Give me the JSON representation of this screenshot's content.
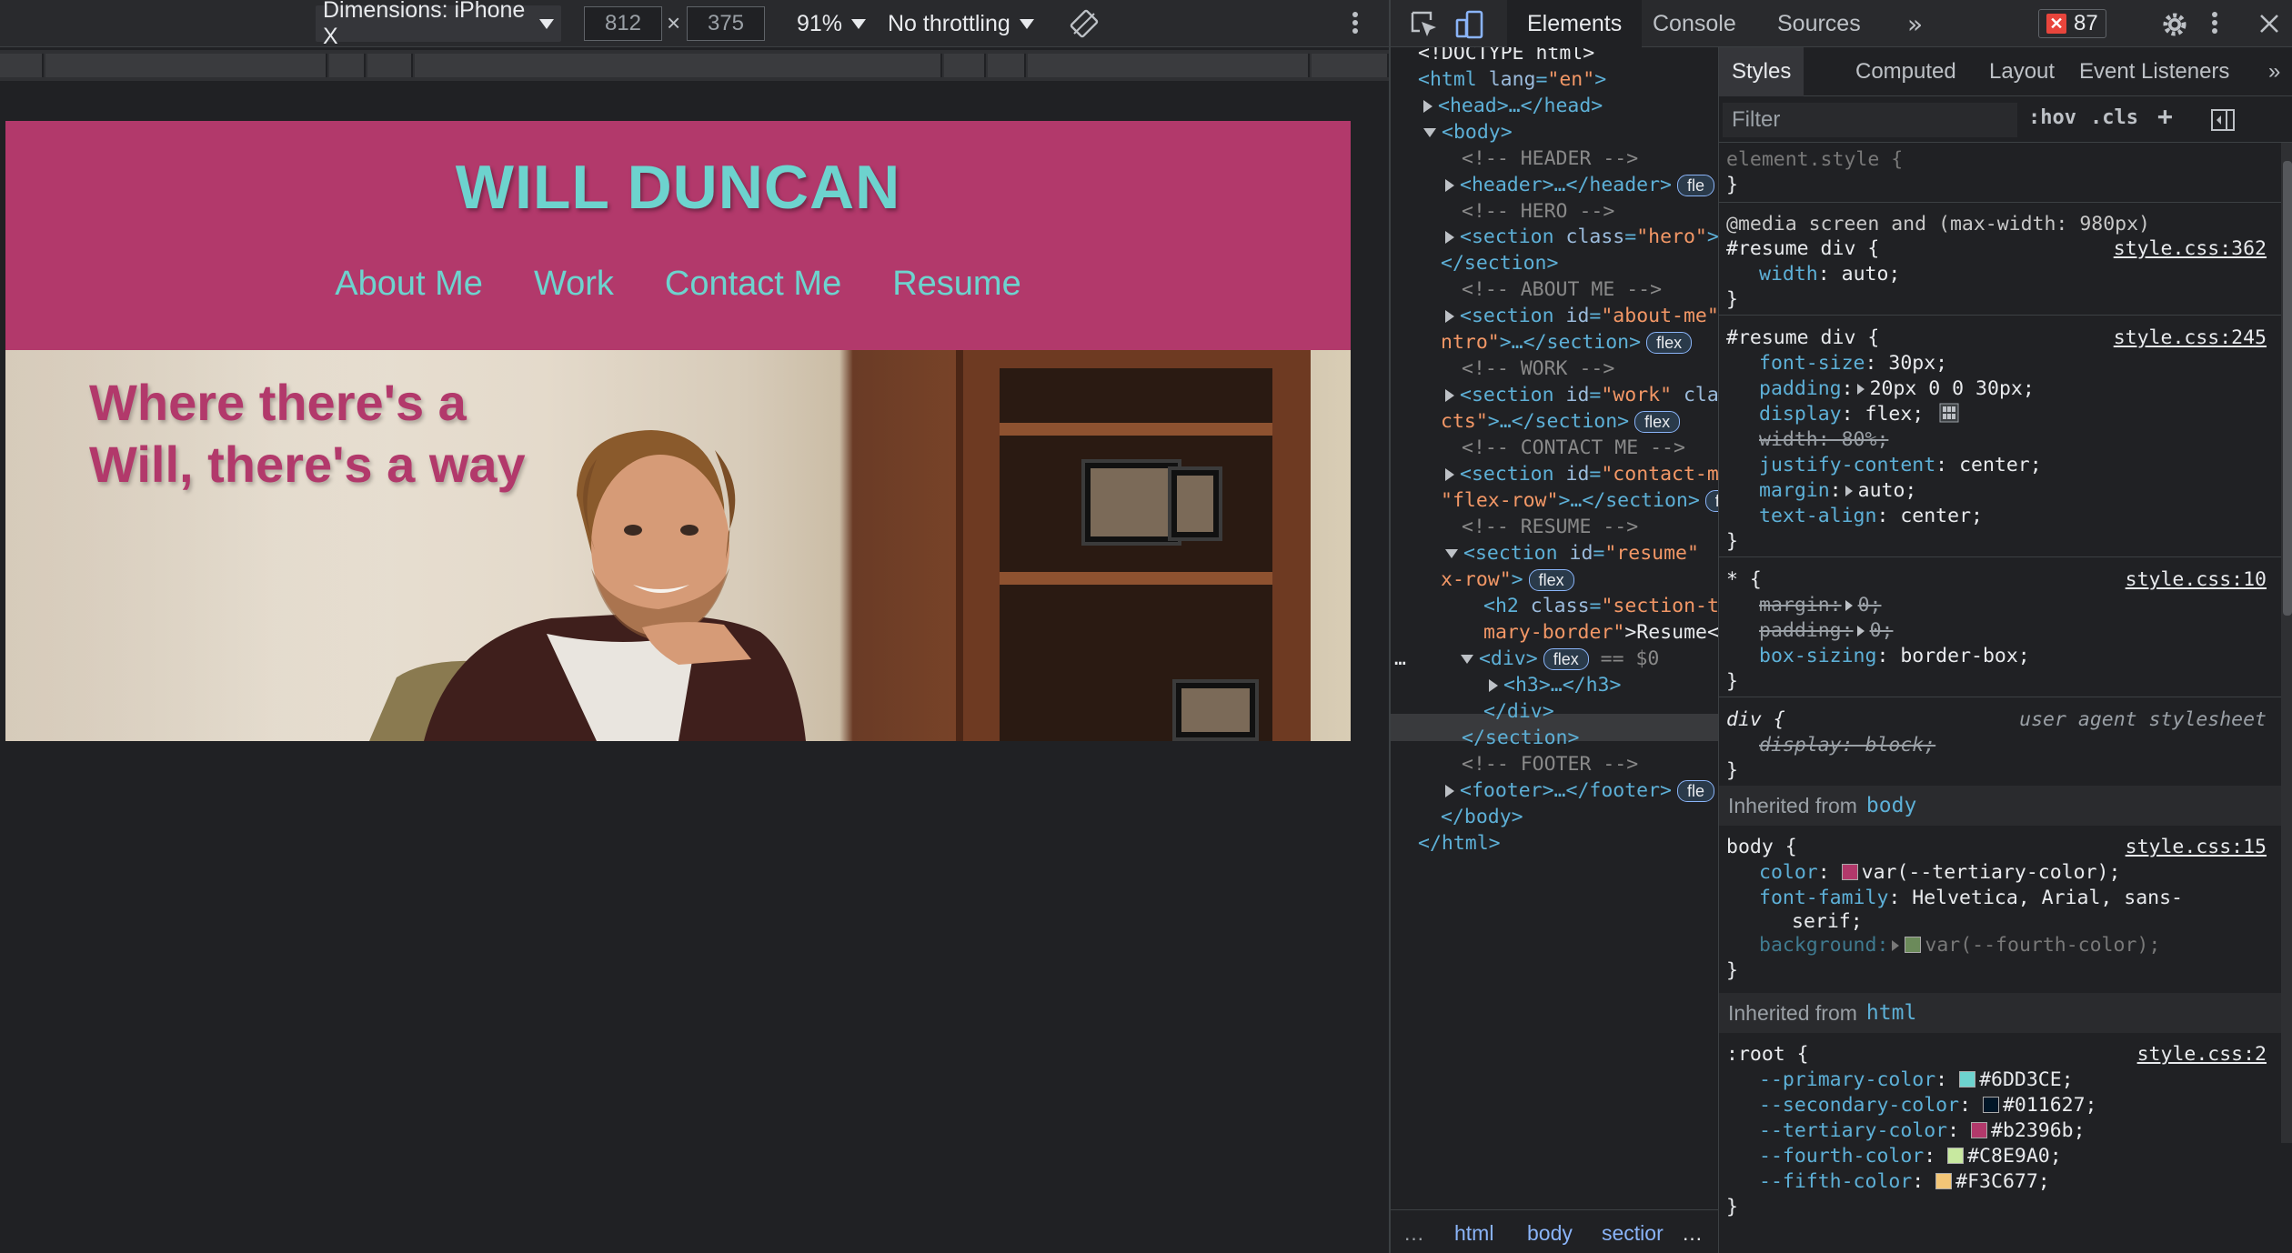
{
  "emulation_toolbar": {
    "device_label": "Dimensions: iPhone X",
    "width_value": "812",
    "height_value": "375",
    "dimension_separator": "×",
    "zoom_label": "91%",
    "throttle_label": "No throttling"
  },
  "site": {
    "title": "WILL DUNCAN",
    "nav": [
      "About Me",
      "Work",
      "Contact Me",
      "Resume"
    ],
    "hero_line1": "Where there's a",
    "hero_line2": "Will, there's a way",
    "colors": {
      "primary": "#6DD3CE",
      "tertiary": "#b2396b"
    }
  },
  "devtools": {
    "tabs": [
      "Elements",
      "Console",
      "Sources"
    ],
    "more_tabs": "»",
    "error_count": "87",
    "dom": {
      "l1": "<!DOCTYPE html>",
      "html_open_tag": "<html",
      "html_attr": "lang",
      "html_attr_val": "\"en\"",
      "html_close_bracket": ">",
      "head": "<head>…</head>",
      "body_open": "<body>",
      "c_header": "<!-- HEADER -->",
      "header": "<header>…</header>",
      "c_hero": "<!-- HERO -->",
      "section_hero_tag": "<section",
      "section_hero_attr": "class",
      "section_hero_val": "\"hero\"",
      "section_close": "</section>",
      "c_about": "<!-- ABOUT ME -->",
      "about_tag": "<section",
      "about_attr": "id",
      "about_val": "\"about-me\"",
      "about_cont_val": "ntro\"",
      "about_cont_tag": ">…</section>",
      "c_work": "<!-- WORK -->",
      "work_tag": "<section",
      "work_attr": "id",
      "work_val": "\"work\"",
      "work_cont_attr": "cla",
      "work_cont_val": "cts\"",
      "work_cont_tag": ">…</section>",
      "c_contact": "<!-- CONTACT ME -->",
      "contact_tag": "<section",
      "contact_attr": "id",
      "contact_val": "\"contact-m",
      "contact_cont_val": "\"flex-row\"",
      "contact_cont_tag": ">…</section>",
      "c_resume": "<!-- RESUME -->",
      "resume_tag": "<section",
      "resume_attr": "id",
      "resume_val": "\"resume\"",
      "resume_cont_val": "x-row\"",
      "resume_cont_tag": ">",
      "h2_tag": "<h2",
      "h2_attr": "class",
      "h2_val": "\"section-t",
      "h2_cont_val": "mary-border\"",
      "h2_cont_text": ">Resume<",
      "div_tag": "<div>",
      "div_eq": "== $0",
      "div_dots": "…",
      "h3": "<h3>…</h3>",
      "div_close": "</div>",
      "resume_section_close": "</section>",
      "c_footer": "<!-- FOOTER -->",
      "footer": "<footer>…</footer>",
      "body_close": "</body>",
      "html_close": "</html>",
      "flex_badge": "flex",
      "flex_partial": "fle"
    },
    "breadcrumbs": [
      "html",
      "body",
      "sectior"
    ],
    "breadcrumb_more": "…",
    "styles_tabs": [
      "Styles",
      "Computed",
      "Layout",
      "Event Listeners"
    ],
    "styles_more": "»",
    "filter_placeholder": "Filter",
    "hov": ":hov",
    "cls": ".cls",
    "plus": "+",
    "rules": {
      "element_style": "element.style {",
      "close": "}",
      "media": "@media screen and (max-width: 980px)",
      "r1_sel": "#resume div {",
      "r1_src": "style.css:362",
      "r1_p1": "width",
      "r1_v1": "auto;",
      "r2_sel": "#resume div {",
      "r2_src": "style.css:245",
      "r2_p1": "font-size",
      "r2_v1": "30px;",
      "r2_p2": "padding",
      "r2_v2": "20px 0 0 30px;",
      "r2_p3": "display",
      "r2_v3": "flex;",
      "r2_p4": "width: 80%;",
      "r2_p5": "justify-content",
      "r2_v5": "center;",
      "r2_p6": "margin",
      "r2_v6": "auto;",
      "r2_p7": "text-align",
      "r2_v7": "center;",
      "r3_sel": "* {",
      "r3_src": "style.css:10",
      "r3_p1": "margin:",
      "r3_v1": "0;",
      "r3_p2": "padding:",
      "r3_v2": "0;",
      "r3_p3": "box-sizing",
      "r3_v3": "border-box;",
      "r4_sel": "div {",
      "r4_src": "user agent stylesheet",
      "r4_p1": "display: block;",
      "inh_body_label": "Inherited from",
      "inh_body_link": "body",
      "r5_sel": "body {",
      "r5_src": "style.css:15",
      "r5_p1": "color",
      "r5_v1": "var(--tertiary-color);",
      "r5_p2": "font-family",
      "r5_v2": "Helvetica, Arial, sans-",
      "r5_v2b": "serif;",
      "r5_p3": "background:",
      "r5_v3": "var(--fourth-color);",
      "inh_html_label": "Inherited from",
      "inh_html_link": "html",
      "r6_sel": ":root {",
      "r6_src": "style.css:2",
      "vars": [
        {
          "name": "--primary-color",
          "value": "#6DD3CE;",
          "swatch": "#6DD3CE"
        },
        {
          "name": "--secondary-color",
          "value": "#011627;",
          "swatch": "#011627"
        },
        {
          "name": "--tertiary-color",
          "value": "#b2396b;",
          "swatch": "#b2396b"
        },
        {
          "name": "--fourth-color",
          "value": "#C8E9A0;",
          "swatch": "#C8E9A0"
        },
        {
          "name": "--fifth-color",
          "value": "#F3C677;",
          "swatch": "#F3C677"
        }
      ]
    }
  }
}
